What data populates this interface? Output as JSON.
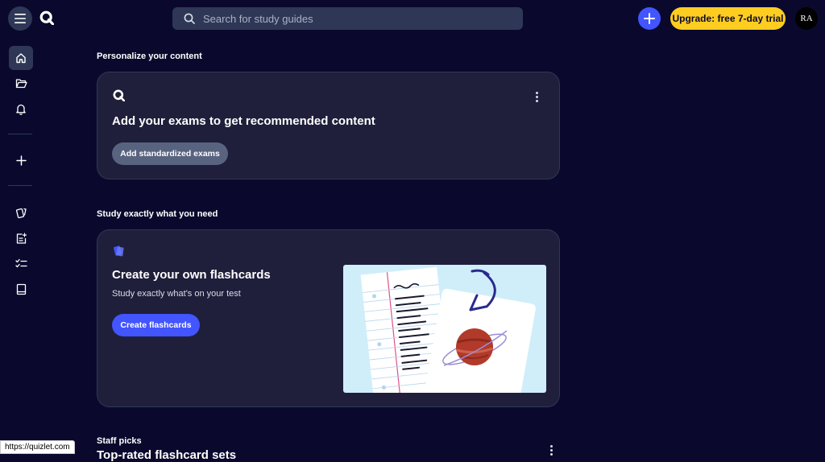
{
  "header": {
    "search_placeholder": "Search for study guides",
    "upgrade_label": "Upgrade: free 7-day trial",
    "avatar_initials": "RA"
  },
  "sidebar": {
    "items": [
      {
        "icon": "home-icon",
        "active": true
      },
      {
        "icon": "folder-icon"
      },
      {
        "icon": "bell-icon"
      },
      {
        "icon": "plus-icon"
      },
      {
        "icon": "flashcards-icon"
      },
      {
        "icon": "study-guide-icon"
      },
      {
        "icon": "checklist-icon"
      },
      {
        "icon": "book-icon"
      }
    ]
  },
  "sections": {
    "personalize": {
      "label": "Personalize your content",
      "title": "Add your exams to get recommended content",
      "button": "Add standardized exams"
    },
    "study": {
      "label": "Study exactly what you need",
      "title": "Create your own flashcards",
      "subtitle": "Study exactly what's on your test",
      "button": "Create flashcards"
    },
    "staff": {
      "label": "Staff picks",
      "partial_title": "Top-rated flashcard sets"
    }
  },
  "status_url": "https://quizlet.com",
  "colors": {
    "background": "#0a092d",
    "surface": "#1f1f3b",
    "accent_blue": "#4255ff",
    "upgrade_yellow": "#ffcd1f"
  }
}
